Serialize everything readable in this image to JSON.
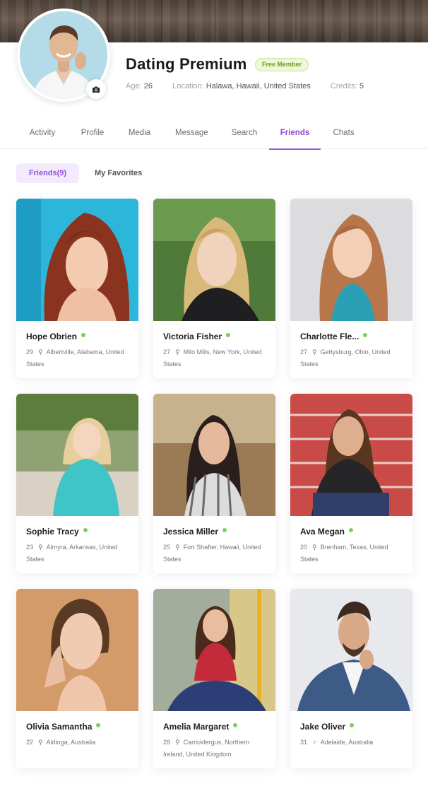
{
  "profile": {
    "name": "Dating Premium",
    "badge": "Free Member",
    "age_label": "Age:",
    "age": "26",
    "location_label": "Location:",
    "location": "Halawa, Hawaii, United States",
    "credits_label": "Credits:",
    "credits": "5"
  },
  "tabs": [
    "Activity",
    "Profile",
    "Media",
    "Message",
    "Search",
    "Friends",
    "Chats"
  ],
  "active_tab": "Friends",
  "subtabs": {
    "friends": "Friends(9)",
    "favorites": "My Favorites"
  },
  "colors": {
    "accent": "#9b57e0",
    "online": "#7bcf5f",
    "badge": "#6b9a1f"
  },
  "friends": [
    {
      "name": "Hope Obrien",
      "age": "29",
      "location": "Albertville, Alabama, United States",
      "gender_icon": "location-pin-icon"
    },
    {
      "name": "Victoria Fisher",
      "age": "27",
      "location": "Milo Mills, New York, United States",
      "gender_icon": "location-pin-icon"
    },
    {
      "name": "Charlotte Fle...",
      "age": "27",
      "location": "Gettysburg, Ohio, United States",
      "gender_icon": "location-pin-icon"
    },
    {
      "name": "Sophie Tracy",
      "age": "23",
      "location": "Almyra, Arkansas, United States",
      "gender_icon": "location-pin-icon"
    },
    {
      "name": "Jessica Miller",
      "age": "25",
      "location": "Fort Shafter, Hawaii, United States",
      "gender_icon": "location-pin-icon"
    },
    {
      "name": "Ava Megan",
      "age": "20",
      "location": "Brenham, Texas, United States",
      "gender_icon": "location-pin-icon"
    },
    {
      "name": "Olivia Samantha",
      "age": "22",
      "location": "Aldinga, Australia",
      "gender_icon": "location-pin-icon"
    },
    {
      "name": "Amelia Margaret",
      "age": "28",
      "location": "Carrickfergus, Northern Ireland, United Kingdom",
      "gender_icon": "location-pin-icon"
    },
    {
      "name": "Jake Oliver",
      "age": "31",
      "location": "Adelaide, Australia",
      "gender_icon": "male-icon"
    }
  ]
}
